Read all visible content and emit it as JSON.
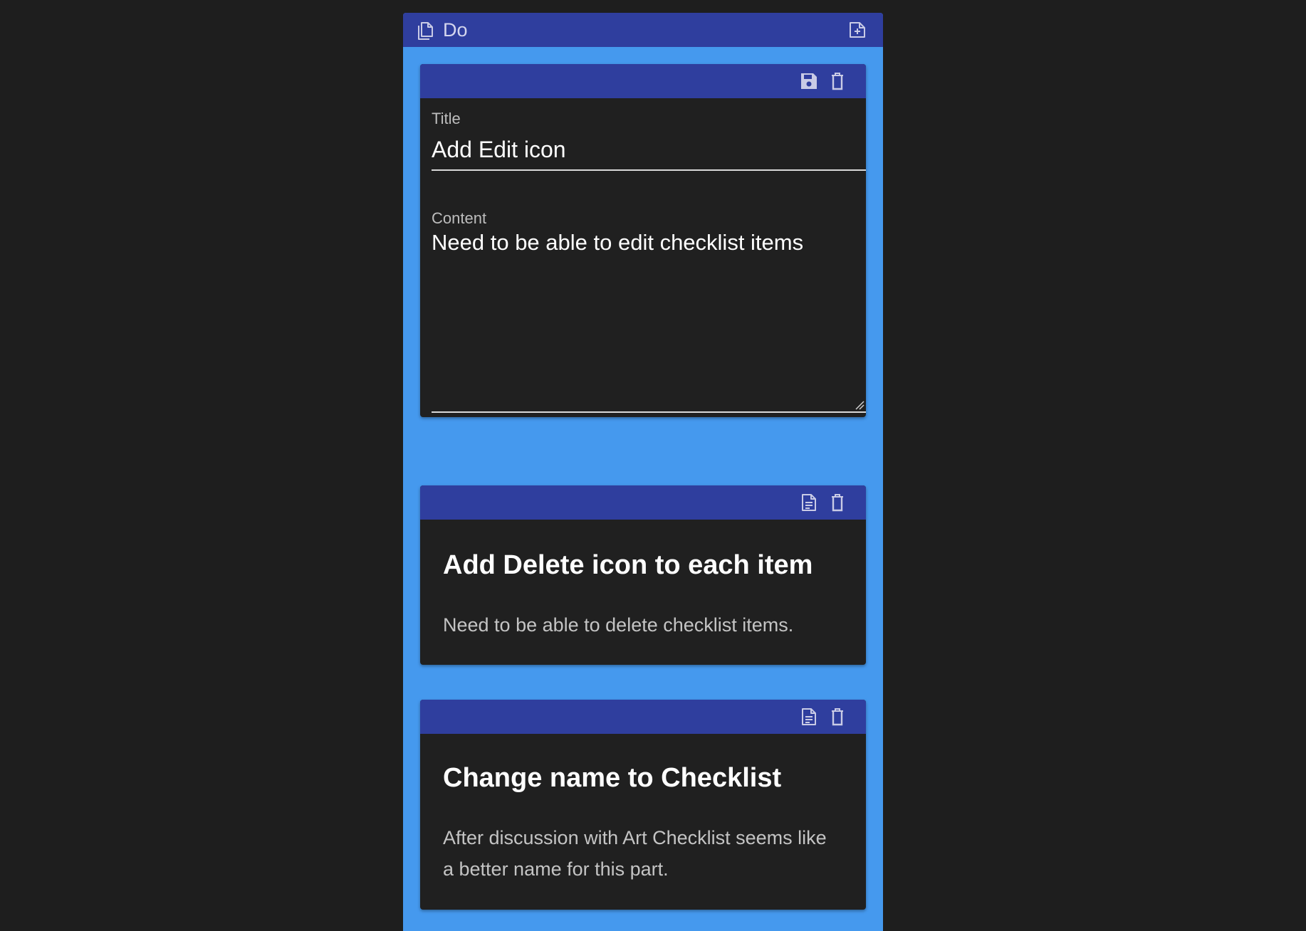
{
  "column": {
    "title": "Do",
    "icons": {
      "board": "multi-document-icon",
      "add": "add-note-icon"
    }
  },
  "edit_card": {
    "header_icons": [
      "save-icon",
      "delete-icon"
    ],
    "title_label": "Title",
    "title_value": "Add Edit icon",
    "content_label": "Content",
    "content_value": "Need to be able to edit checklist items"
  },
  "cards": [
    {
      "header_icons": [
        "edit-note-icon",
        "delete-icon"
      ],
      "title": "Add Delete icon to each item",
      "body": "Need to be able to delete checklist items."
    },
    {
      "header_icons": [
        "edit-note-icon",
        "delete-icon"
      ],
      "title": "Change name to Checklist",
      "body": "After discussion with Art Checklist seems like a better name for this part."
    }
  ],
  "colors": {
    "page_bg": "#1e1e1e",
    "column_bg": "#4599ee",
    "header_bg": "#2f3e9e",
    "card_bg": "#202020",
    "icon": "#c9cbe6"
  }
}
